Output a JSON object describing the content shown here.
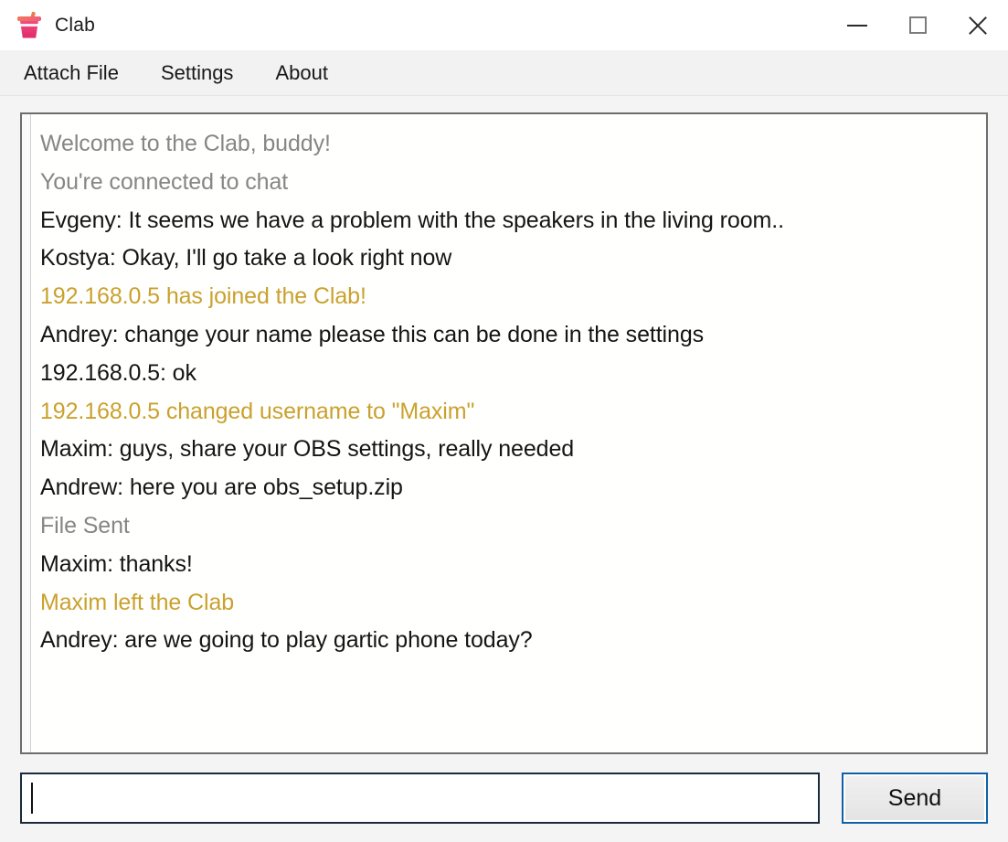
{
  "window": {
    "title": "Clab",
    "icon": "drink-cup-icon",
    "controls": {
      "minimize": "minimize-icon",
      "maximize": "maximize-icon",
      "close": "close-icon"
    }
  },
  "menu": {
    "items": [
      {
        "label": "Attach File"
      },
      {
        "label": "Settings"
      },
      {
        "label": "About"
      }
    ]
  },
  "chat": {
    "messages": [
      {
        "text": "Welcome to the Clab, buddy!",
        "kind": "system"
      },
      {
        "text": "You're connected to chat",
        "kind": "system"
      },
      {
        "text": "Evgeny: It seems we have a problem with the speakers in the living room..",
        "kind": "user"
      },
      {
        "text": "Kostya: Okay, I'll go take a look right now",
        "kind": "user"
      },
      {
        "text": "192.168.0.5 has joined the Clab!",
        "kind": "notice"
      },
      {
        "text": "Andrey: change your name please this can be done in the settings",
        "kind": "user"
      },
      {
        "text": "192.168.0.5: ok",
        "kind": "user"
      },
      {
        "text": "192.168.0.5 changed username to \"Maxim\"",
        "kind": "notice"
      },
      {
        "text": "Maxim: guys, share your OBS settings, really needed",
        "kind": "user"
      },
      {
        "text": "Andrew: here you are obs_setup.zip",
        "kind": "user"
      },
      {
        "text": "File Sent",
        "kind": "system"
      },
      {
        "text": "Maxim: thanks!",
        "kind": "user"
      },
      {
        "text": "Maxim left the Clab",
        "kind": "notice"
      },
      {
        "text": "Andrey: are we going to play gartic phone today?",
        "kind": "user"
      }
    ]
  },
  "composer": {
    "input_value": "",
    "input_placeholder": "",
    "send_label": "Send"
  },
  "colors": {
    "notice": "#caa12e",
    "system": "#868686",
    "user": "#151515",
    "send_border": "#1060a8",
    "input_border": "#1b2a3d",
    "menubar_bg": "#f2f2f2",
    "window_bg": "#f4f4f4"
  }
}
